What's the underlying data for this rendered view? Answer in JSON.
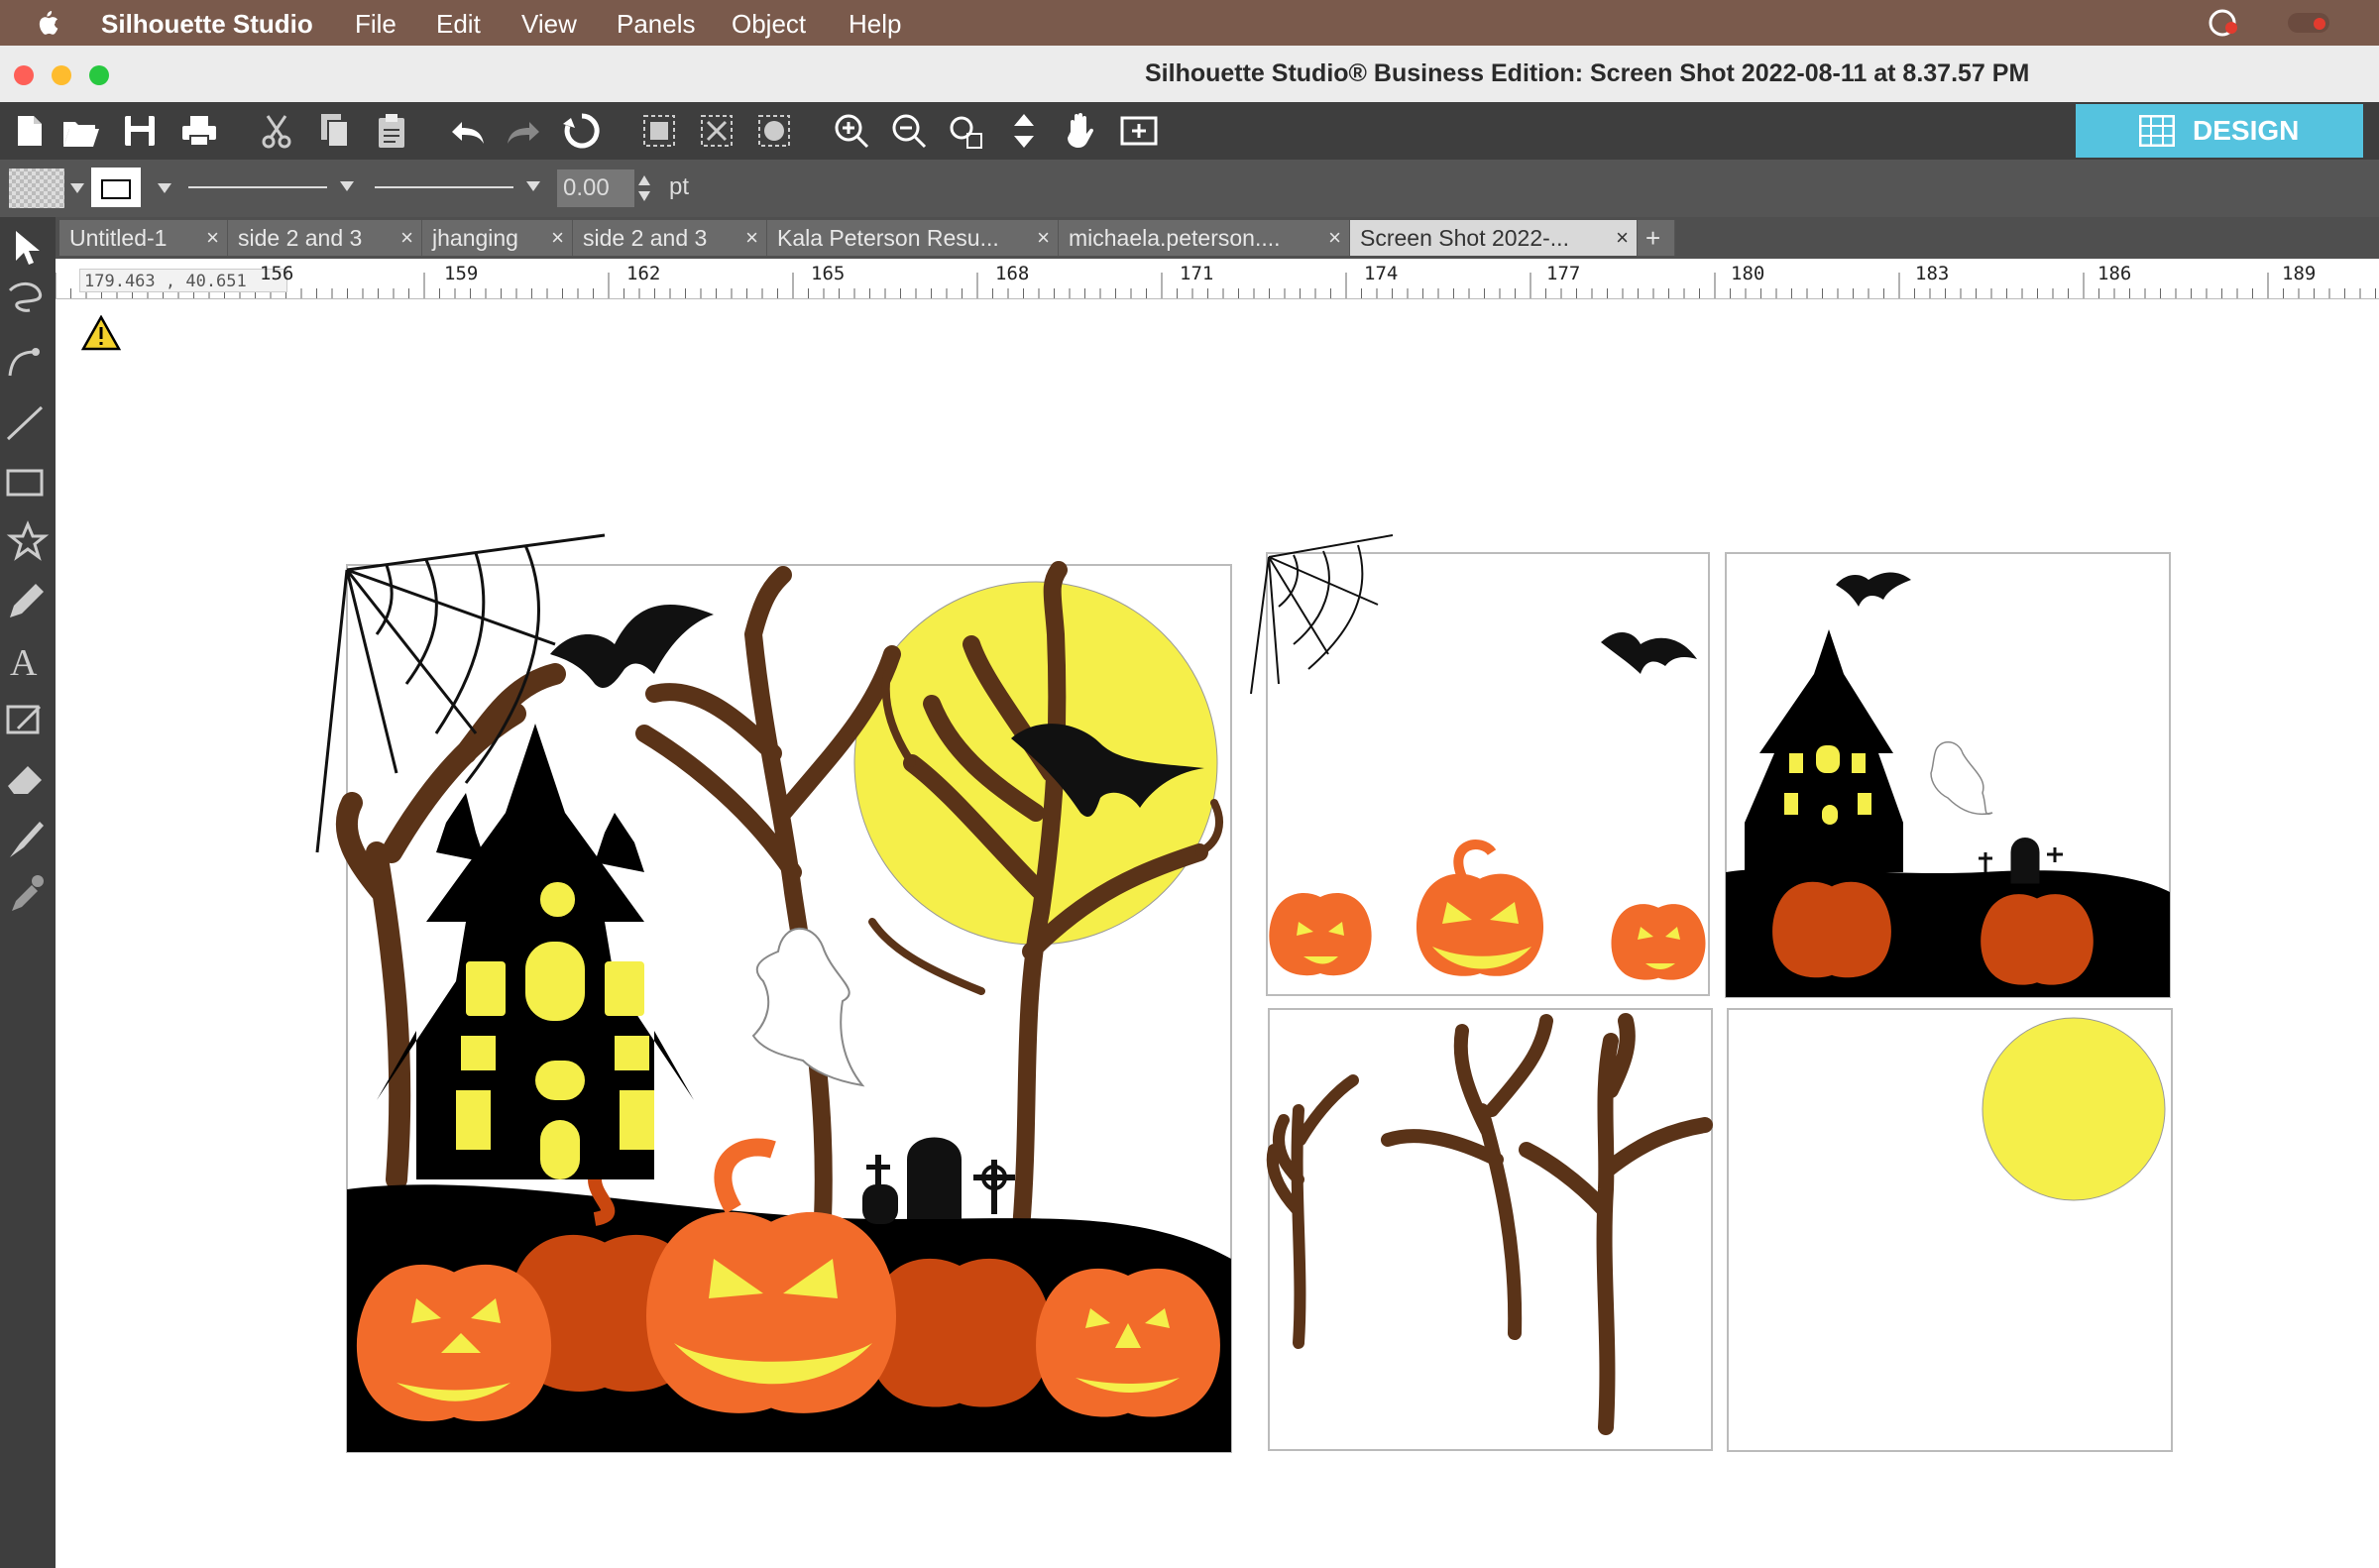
{
  "menubar": {
    "app_name": "Silhouette Studio",
    "items": [
      "File",
      "Edit",
      "View",
      "Panels",
      "Object",
      "Help"
    ]
  },
  "window": {
    "title": "Silhouette Studio® Business Edition: Screen Shot 2022-08-11 at 8.37.57 PM"
  },
  "toolbar": {
    "icons": [
      "new-document",
      "open-folder",
      "save",
      "print",
      "cut",
      "copy",
      "paste",
      "undo",
      "redo",
      "replicate",
      "group",
      "ungroup",
      "nudge",
      "zoom-in",
      "zoom-out",
      "zoom-selection",
      "drag-view",
      "pan-hand",
      "fit-to-page"
    ],
    "design_label": "DESIGN"
  },
  "properties": {
    "line_width_value": "0.00",
    "line_width_unit": "pt"
  },
  "tabs": [
    {
      "label": "Untitled-1",
      "active": false
    },
    {
      "label": "side 2 and 3",
      "active": false
    },
    {
      "label": "jhanging",
      "active": false
    },
    {
      "label": "side 2 and 3",
      "active": false
    },
    {
      "label": "Kala Peterson Resu...",
      "active": false
    },
    {
      "label": "michaela.peterson....",
      "active": false
    },
    {
      "label": "Screen Shot 2022-...",
      "active": true
    }
  ],
  "ruler": {
    "coordinates": "179.463 , 40.651",
    "ticks": [
      "156",
      "159",
      "162",
      "165",
      "168",
      "171",
      "174",
      "177",
      "180",
      "183",
      "186",
      "189"
    ]
  },
  "colors": {
    "menubar": "#7a5a4c",
    "toolbar": "#3e3e3e",
    "design_accent": "#55c3df",
    "pumpkin": "#f26b2a",
    "pumpkin_dark": "#c9470f",
    "moon": "#f5ef4a",
    "tree": "#5a3318",
    "window_glow": "#f5ef4a"
  },
  "canvas": {
    "warning_icon": "warning-triangle-icon",
    "artwork": [
      "halloween-scene-composite",
      "cobweb-bats-pumpkins-panel",
      "haunted-house-panel",
      "dead-trees-panel",
      "moon-panel"
    ]
  }
}
